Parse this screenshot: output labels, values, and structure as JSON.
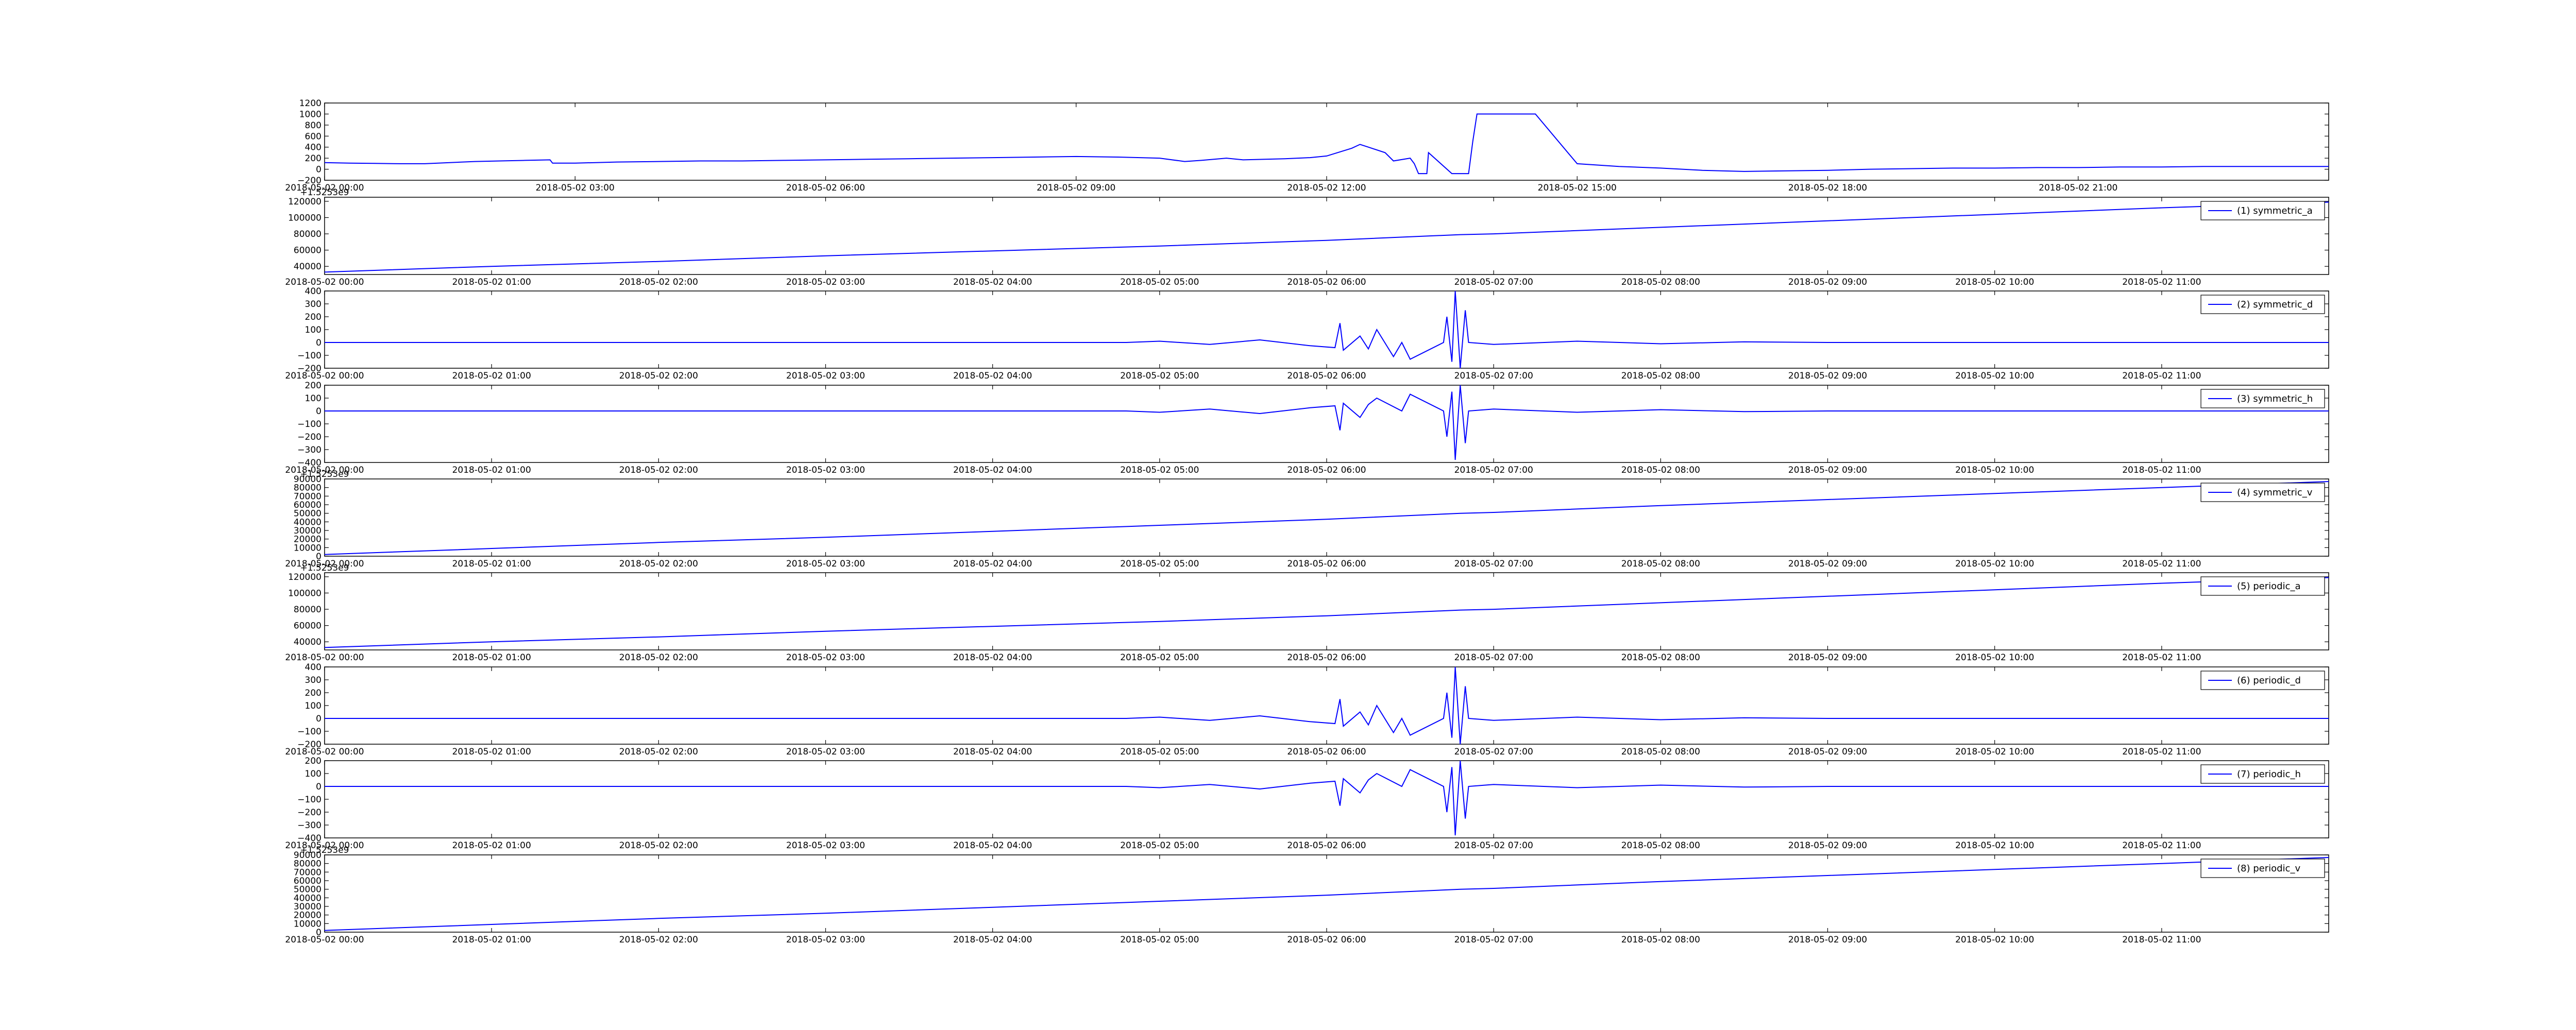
{
  "figure": {
    "background": "#ffffff",
    "line_color": "#0000ff",
    "axis_color": "#000000"
  },
  "chart_data": [
    {
      "type": "line",
      "title": "",
      "xlabel": "",
      "ylabel": "",
      "legend": null,
      "offset_text": "",
      "ylim": [
        -200,
        1200
      ],
      "yticks": [
        -200,
        0,
        200,
        400,
        600,
        800,
        1000,
        1200
      ],
      "xticks": [
        "2018-05-02 00:00",
        "2018-05-02 03:00",
        "2018-05-02 06:00",
        "2018-05-02 09:00",
        "2018-05-02 12:00",
        "2018-05-02 15:00",
        "2018-05-02 18:00",
        "2018-05-02 21:00"
      ],
      "series": [
        {
          "x": [
            0,
            0.3,
            0.6,
            0.9,
            1.2,
            1.5,
            1.8,
            2.1,
            2.4,
            2.7,
            2.73,
            3,
            3.5,
            4,
            4.5,
            5,
            5.5,
            6,
            6.5,
            7,
            7.5,
            8,
            8.5,
            9,
            9.5,
            10,
            10.3,
            10.5,
            10.8,
            11,
            11.5,
            11.8,
            12,
            12.3,
            12.4,
            12.5,
            12.7,
            12.8,
            13,
            13.05,
            13.1,
            13.2,
            13.22,
            13.5,
            13.6,
            13.7,
            13.75,
            13.8,
            14,
            14.5,
            15,
            15.5,
            16,
            16.5,
            17,
            17.5,
            18,
            18.5,
            19,
            19.5,
            20,
            20.5,
            21,
            21.5,
            22,
            22.5,
            23,
            23.5,
            24
          ],
          "values": [
            120,
            110,
            105,
            100,
            100,
            120,
            140,
            150,
            160,
            170,
            110,
            110,
            130,
            140,
            150,
            150,
            160,
            170,
            180,
            190,
            200,
            210,
            220,
            230,
            220,
            200,
            140,
            160,
            200,
            170,
            190,
            210,
            240,
            380,
            450,
            400,
            300,
            150,
            200,
            100,
            -80,
            -80,
            300,
            -80,
            -80,
            -80,
            500,
            1000,
            1000,
            1000,
            100,
            50,
            20,
            -20,
            -40,
            -30,
            -20,
            0,
            10,
            20,
            20,
            30,
            30,
            40,
            40,
            50,
            50,
            50,
            50
          ]
        }
      ]
    },
    {
      "type": "line",
      "title": "",
      "xlabel": "",
      "ylabel": "",
      "legend": "(1) symmetric_a",
      "offset_text": "+1.5253e9",
      "ylim": [
        30000,
        125000
      ],
      "yticks": [
        40000,
        60000,
        80000,
        100000,
        120000
      ],
      "xticks": [
        "2018-05-02 00:00",
        "2018-05-02 01:00",
        "2018-05-02 02:00",
        "2018-05-02 03:00",
        "2018-05-02 04:00",
        "2018-05-02 05:00",
        "2018-05-02 06:00",
        "2018-05-02 07:00",
        "2018-05-02 08:00",
        "2018-05-02 09:00",
        "2018-05-02 10:00",
        "2018-05-02 11:00"
      ],
      "series": [
        {
          "x": [
            0,
            1,
            2,
            3,
            4,
            5,
            6,
            6.8,
            7,
            8,
            9,
            10,
            11,
            12
          ],
          "values": [
            33000,
            40000,
            46000,
            53000,
            59000,
            65000,
            72000,
            79000,
            80000,
            88000,
            96000,
            104000,
            112000,
            119000
          ]
        }
      ]
    },
    {
      "type": "line",
      "title": "",
      "xlabel": "",
      "ylabel": "",
      "legend": "(2) symmetric_d",
      "offset_text": "",
      "ylim": [
        -200,
        400
      ],
      "yticks": [
        -200,
        -100,
        0,
        100,
        200,
        300,
        400
      ],
      "xticks": [
        "2018-05-02 00:00",
        "2018-05-02 01:00",
        "2018-05-02 02:00",
        "2018-05-02 03:00",
        "2018-05-02 04:00",
        "2018-05-02 05:00",
        "2018-05-02 06:00",
        "2018-05-02 07:00",
        "2018-05-02 08:00",
        "2018-05-02 09:00",
        "2018-05-02 10:00",
        "2018-05-02 11:00"
      ],
      "series": [
        {
          "x": [
            0,
            4.8,
            5,
            5.3,
            5.6,
            5.9,
            6.05,
            6.08,
            6.1,
            6.2,
            6.25,
            6.3,
            6.4,
            6.45,
            6.5,
            6.7,
            6.72,
            6.75,
            6.77,
            6.8,
            6.83,
            6.85,
            7,
            7.5,
            8,
            8.5,
            9,
            12
          ],
          "values": [
            0,
            0,
            10,
            -15,
            20,
            -25,
            -40,
            150,
            -60,
            50,
            -50,
            100,
            -110,
            0,
            -130,
            0,
            200,
            -150,
            400,
            -200,
            250,
            0,
            -15,
            10,
            -10,
            5,
            0,
            0
          ]
        }
      ]
    },
    {
      "type": "line",
      "title": "",
      "xlabel": "",
      "ylabel": "",
      "legend": "(3) symmetric_h",
      "offset_text": "",
      "ylim": [
        -400,
        200
      ],
      "yticks": [
        -400,
        -300,
        -200,
        -100,
        0,
        100,
        200
      ],
      "xticks": [
        "2018-05-02 00:00",
        "2018-05-02 01:00",
        "2018-05-02 02:00",
        "2018-05-02 03:00",
        "2018-05-02 04:00",
        "2018-05-02 05:00",
        "2018-05-02 06:00",
        "2018-05-02 07:00",
        "2018-05-02 08:00",
        "2018-05-02 09:00",
        "2018-05-02 10:00",
        "2018-05-02 11:00"
      ],
      "series": [
        {
          "x": [
            0,
            4.8,
            5,
            5.3,
            5.6,
            5.9,
            6.05,
            6.08,
            6.1,
            6.2,
            6.25,
            6.3,
            6.45,
            6.5,
            6.7,
            6.72,
            6.75,
            6.77,
            6.8,
            6.83,
            6.85,
            7,
            7.5,
            8,
            8.5,
            9,
            12
          ],
          "values": [
            0,
            0,
            -10,
            15,
            -20,
            25,
            40,
            -150,
            60,
            -50,
            50,
            100,
            0,
            130,
            0,
            -200,
            150,
            -380,
            200,
            -250,
            0,
            15,
            -10,
            10,
            -5,
            0,
            0
          ]
        }
      ]
    },
    {
      "type": "line",
      "title": "",
      "xlabel": "",
      "ylabel": "",
      "legend": "(4) symmetric_v",
      "offset_text": "+1.5253e9",
      "ylim": [
        0,
        90000
      ],
      "yticks": [
        0,
        10000,
        20000,
        30000,
        40000,
        50000,
        60000,
        70000,
        80000,
        90000
      ],
      "xticks": [
        "2018-05-02 00:00",
        "2018-05-02 01:00",
        "2018-05-02 02:00",
        "2018-05-02 03:00",
        "2018-05-02 04:00",
        "2018-05-02 05:00",
        "2018-05-02 06:00",
        "2018-05-02 07:00",
        "2018-05-02 08:00",
        "2018-05-02 09:00",
        "2018-05-02 10:00",
        "2018-05-02 11:00"
      ],
      "series": [
        {
          "x": [
            0,
            1,
            2,
            3,
            4,
            5,
            6,
            6.8,
            7,
            8,
            9,
            10,
            11,
            12
          ],
          "values": [
            2000,
            9000,
            16000,
            22000,
            29000,
            36000,
            43000,
            50000,
            51000,
            59000,
            66000,
            73000,
            80000,
            87000
          ]
        }
      ]
    },
    {
      "type": "line",
      "title": "",
      "xlabel": "",
      "ylabel": "",
      "legend": "(5) periodic_a",
      "offset_text": "+1.5253e9",
      "ylim": [
        30000,
        125000
      ],
      "yticks": [
        40000,
        60000,
        80000,
        100000,
        120000
      ],
      "xticks": [
        "2018-05-02 00:00",
        "2018-05-02 01:00",
        "2018-05-02 02:00",
        "2018-05-02 03:00",
        "2018-05-02 04:00",
        "2018-05-02 05:00",
        "2018-05-02 06:00",
        "2018-05-02 07:00",
        "2018-05-02 08:00",
        "2018-05-02 09:00",
        "2018-05-02 10:00",
        "2018-05-02 11:00"
      ],
      "series": [
        {
          "x": [
            0,
            1,
            2,
            3,
            4,
            5,
            6,
            6.8,
            7,
            8,
            9,
            10,
            11,
            12
          ],
          "values": [
            33000,
            40000,
            46000,
            53000,
            59000,
            65000,
            72000,
            79000,
            80000,
            88000,
            96000,
            104000,
            112000,
            119000
          ]
        }
      ]
    },
    {
      "type": "line",
      "title": "",
      "xlabel": "",
      "ylabel": "",
      "legend": "(6) periodic_d",
      "offset_text": "",
      "ylim": [
        -200,
        400
      ],
      "yticks": [
        -200,
        -100,
        0,
        100,
        200,
        300,
        400
      ],
      "xticks": [
        "2018-05-02 00:00",
        "2018-05-02 01:00",
        "2018-05-02 02:00",
        "2018-05-02 03:00",
        "2018-05-02 04:00",
        "2018-05-02 05:00",
        "2018-05-02 06:00",
        "2018-05-02 07:00",
        "2018-05-02 08:00",
        "2018-05-02 09:00",
        "2018-05-02 10:00",
        "2018-05-02 11:00"
      ],
      "series": [
        {
          "x": [
            0,
            4.8,
            5,
            5.3,
            5.6,
            5.9,
            6.05,
            6.08,
            6.1,
            6.2,
            6.25,
            6.3,
            6.4,
            6.45,
            6.5,
            6.7,
            6.72,
            6.75,
            6.77,
            6.8,
            6.83,
            6.85,
            7,
            7.5,
            8,
            8.5,
            9,
            12
          ],
          "values": [
            0,
            0,
            10,
            -15,
            20,
            -25,
            -40,
            150,
            -60,
            50,
            -50,
            100,
            -110,
            0,
            -130,
            0,
            200,
            -150,
            400,
            -200,
            250,
            0,
            -15,
            10,
            -10,
            5,
            0,
            0
          ]
        }
      ]
    },
    {
      "type": "line",
      "title": "",
      "xlabel": "",
      "ylabel": "",
      "legend": "(7) periodic_h",
      "offset_text": "",
      "ylim": [
        -400,
        200
      ],
      "yticks": [
        -400,
        -300,
        -200,
        -100,
        0,
        100,
        200
      ],
      "xticks": [
        "2018-05-02 00:00",
        "2018-05-02 01:00",
        "2018-05-02 02:00",
        "2018-05-02 03:00",
        "2018-05-02 04:00",
        "2018-05-02 05:00",
        "2018-05-02 06:00",
        "2018-05-02 07:00",
        "2018-05-02 08:00",
        "2018-05-02 09:00",
        "2018-05-02 10:00",
        "2018-05-02 11:00"
      ],
      "series": [
        {
          "x": [
            0,
            4.8,
            5,
            5.3,
            5.6,
            5.9,
            6.05,
            6.08,
            6.1,
            6.2,
            6.25,
            6.3,
            6.45,
            6.5,
            6.7,
            6.72,
            6.75,
            6.77,
            6.8,
            6.83,
            6.85,
            7,
            7.5,
            8,
            8.5,
            9,
            12
          ],
          "values": [
            0,
            0,
            -10,
            15,
            -20,
            25,
            40,
            -150,
            60,
            -50,
            50,
            100,
            0,
            130,
            0,
            -200,
            150,
            -380,
            200,
            -250,
            0,
            15,
            -10,
            10,
            -5,
            0,
            0
          ]
        }
      ]
    },
    {
      "type": "line",
      "title": "",
      "xlabel": "",
      "ylabel": "",
      "legend": "(8) periodic_v",
      "offset_text": "+1.5253e9",
      "ylim": [
        0,
        90000
      ],
      "yticks": [
        0,
        10000,
        20000,
        30000,
        40000,
        50000,
        60000,
        70000,
        80000,
        90000
      ],
      "xticks": [
        "2018-05-02 00:00",
        "2018-05-02 01:00",
        "2018-05-02 02:00",
        "2018-05-02 03:00",
        "2018-05-02 04:00",
        "2018-05-02 05:00",
        "2018-05-02 06:00",
        "2018-05-02 07:00",
        "2018-05-02 08:00",
        "2018-05-02 09:00",
        "2018-05-02 10:00",
        "2018-05-02 11:00"
      ],
      "series": [
        {
          "x": [
            0,
            1,
            2,
            3,
            4,
            5,
            6,
            6.8,
            7,
            8,
            9,
            10,
            11,
            12
          ],
          "values": [
            2000,
            9000,
            16000,
            22000,
            29000,
            36000,
            43000,
            50000,
            51000,
            59000,
            66000,
            73000,
            80000,
            87000
          ]
        }
      ]
    }
  ]
}
